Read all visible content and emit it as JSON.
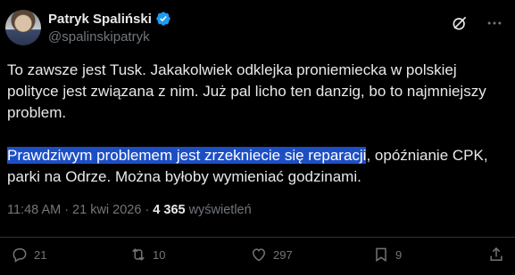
{
  "author": {
    "display_name": "Patryk Spaliński",
    "handle": "@spalinskipatryk",
    "verified": true
  },
  "tweet": {
    "paragraph1": "To zawsze jest Tusk. Jakakolwiek odklejka proniemiecka w polskiej polityce jest związana z nim. Już pal licho ten danzig, bo to najmniejszy problem.",
    "paragraph2_highlight": "Prawdziwym problemem jest zrzekniecie się reparacji",
    "paragraph2_rest": ", opóźnianie CPK, parki na Odrze. Można byłoby wymieniać godzinami."
  },
  "meta": {
    "time": "11:48 AM",
    "separator": "·",
    "date": "21 kwi 2026",
    "views_count": "4 365",
    "views_label": "wyświetleń"
  },
  "actions": {
    "replies": "21",
    "reposts": "10",
    "likes": "297",
    "bookmarks": "9"
  },
  "colors": {
    "background": "#000000",
    "text": "#e7e9ea",
    "secondary": "#71767b",
    "highlight": "#1d4fc4",
    "verified": "#1d9bf0"
  },
  "icons": [
    "grok-icon",
    "more-icon",
    "reply-icon",
    "repost-icon",
    "like-icon",
    "bookmark-icon",
    "share-icon"
  ]
}
